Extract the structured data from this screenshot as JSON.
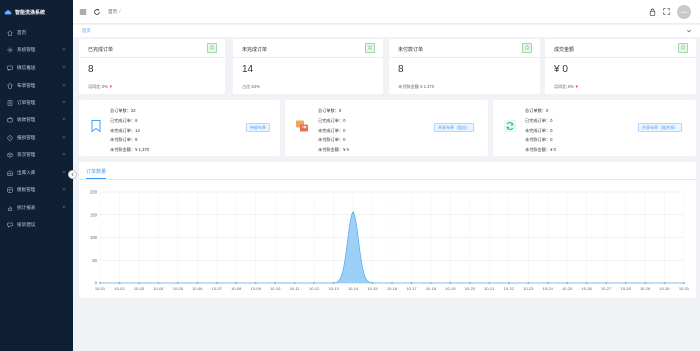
{
  "app": {
    "title": "智能洗涤系统"
  },
  "sidebar": {
    "items": [
      {
        "label": "首页",
        "icon": "home-icon",
        "has_arrow": false
      },
      {
        "label": "系统管理",
        "icon": "gear-icon",
        "has_arrow": true
      },
      {
        "label": "微信推送",
        "icon": "wechat-icon",
        "has_arrow": true
      },
      {
        "label": "布草管理",
        "icon": "cloth-icon",
        "has_arrow": true
      },
      {
        "label": "订单管理",
        "icon": "order-icon",
        "has_arrow": true
      },
      {
        "label": "收款管理",
        "icon": "wallet-icon",
        "has_arrow": true
      },
      {
        "label": "报损管理",
        "icon": "damage-icon",
        "has_arrow": true
      },
      {
        "label": "货次管理",
        "icon": "box-icon",
        "has_arrow": true
      },
      {
        "label": "出库入库",
        "icon": "warehouse-icon",
        "has_arrow": true
      },
      {
        "label": "模板管理",
        "icon": "template-icon",
        "has_arrow": true
      },
      {
        "label": "统计报表",
        "icon": "report-icon",
        "has_arrow": true
      },
      {
        "label": "投诉建议",
        "icon": "feedback-icon",
        "has_arrow": false
      }
    ]
  },
  "header": {
    "breadcrumb": "首页",
    "breadcrumb_sep": "/",
    "avatar_text": "avatar"
  },
  "tags": {
    "home": "首页"
  },
  "stats": [
    {
      "title": "已完成订单",
      "badge": "月",
      "value": "8",
      "foot_label": "月同比 0%",
      "foot_arrow": "▼"
    },
    {
      "title": "未完成订单",
      "badge": "月",
      "value": "14",
      "foot_label": "占比 64%",
      "foot_arrow": ""
    },
    {
      "title": "未付款订单",
      "badge": "月",
      "value": "8",
      "foot_label": "未付款金额 ¥ 1,370",
      "foot_arrow": ""
    },
    {
      "title": "成交金额",
      "badge": "月",
      "value": "¥ 0",
      "foot_label": "月同比 0%",
      "foot_arrow": "▼"
    }
  ],
  "summaries": [
    {
      "icon": "bookmark-icon",
      "lines": [
        "总订单数：22",
        "已完成订单：8",
        "未完成订单：14",
        "未付款订单：8",
        "未付款金额：¥ 1,370"
      ],
      "button": "待收布草"
    },
    {
      "icon": "exchange-icon",
      "lines": [
        "总订单数：0",
        "已完成订单：0",
        "未完成订单：0",
        "未付款订单：0",
        "未付款金额：¥ 0"
      ],
      "button": "共享布草（租出）"
    },
    {
      "icon": "cycle-icon",
      "lines": [
        "总订单数：0",
        "已完成订单：0",
        "未完成订单：0",
        "未付款订单：0",
        "未付款金额：¥ 0"
      ],
      "button": "共享布草（纯共享）"
    }
  ],
  "chart_tab": "订单数量",
  "colors": {
    "accent": "#409eff",
    "sidebar_bg": "#0f2034",
    "area_fill": "#8cc8f5",
    "area_stroke": "#409eff",
    "badge_green": "#4a9d5b"
  },
  "chart_data": {
    "type": "area",
    "categories": [
      "10-01",
      "10-02",
      "10-03",
      "10-04",
      "10-05",
      "10-06",
      "10-07",
      "10-08",
      "10-09",
      "10-10",
      "10-11",
      "10-12",
      "10-13",
      "10-14",
      "10-15",
      "10-16",
      "10-17",
      "10-18",
      "10-19",
      "10-20",
      "10-21",
      "10-22",
      "10-23",
      "10-24",
      "10-25",
      "10-26",
      "10-27",
      "10-28",
      "10-29",
      "10-30",
      "10-31"
    ],
    "values": [
      0,
      0,
      0,
      0,
      0,
      0,
      0,
      0,
      0,
      0,
      0,
      0,
      0,
      155,
      0,
      0,
      0,
      0,
      0,
      0,
      0,
      0,
      0,
      0,
      0,
      0,
      0,
      0,
      0,
      0,
      0
    ],
    "ylim": [
      0,
      200
    ],
    "yticks": [
      0,
      50,
      100,
      150,
      200
    ],
    "title": "",
    "xlabel": "",
    "ylabel": "",
    "grid": true,
    "smooth": true
  }
}
